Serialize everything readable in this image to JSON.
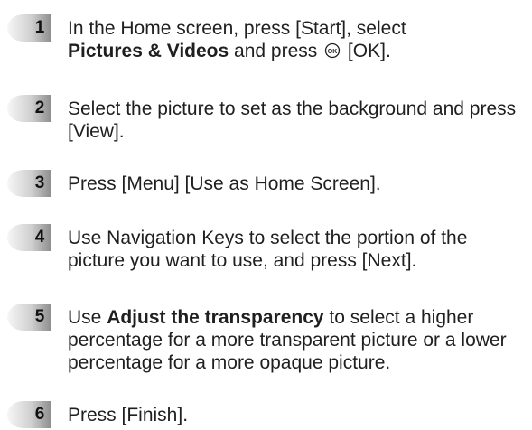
{
  "steps": [
    {
      "number": "1",
      "parts": {
        "a": "In the Home screen, press [Start], select",
        "b": "Pictures & Videos",
        "c": " and press ",
        "d": " [OK]."
      },
      "ok_icon_label": "OK"
    },
    {
      "number": "2",
      "text": "Select the picture to set as the background and press [View]."
    },
    {
      "number": "3",
      "text": "Press [Menu] [Use as Home Screen]."
    },
    {
      "number": "4",
      "text": "Use Navigation Keys to select the portion of the picture you want to use, and press [Next]."
    },
    {
      "number": "5",
      "parts": {
        "a": "Use ",
        "b": "Adjust the transparency",
        "c": " to select a higher percentage for a more transparent picture or a lower percentage for a more opaque picture."
      }
    },
    {
      "number": "6",
      "text": "Press [Finish]."
    }
  ],
  "colors": {
    "badge_light": "#f2f2f2",
    "badge_dark": "#9a9a9a",
    "text": "#1f1f1f"
  }
}
